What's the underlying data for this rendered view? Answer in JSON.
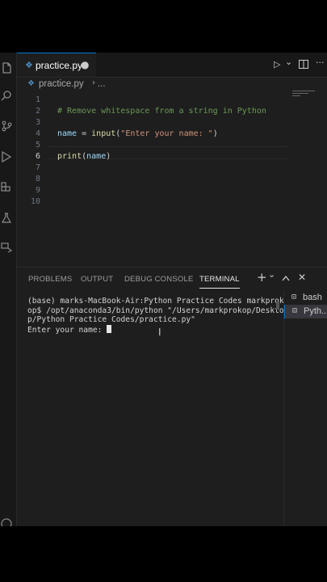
{
  "tab": {
    "filename": "practice.py",
    "close": "●"
  },
  "toolbar": {
    "run": "▷",
    "dropdown": "⌄",
    "split": "▯▯",
    "more": "···"
  },
  "breadcrumb": {
    "file": "practice.py",
    "separator": "›",
    "more": "..."
  },
  "editor": {
    "line_numbers": [
      "1",
      "2",
      "3",
      "4",
      "5",
      "6",
      "7",
      "8",
      "9",
      "10"
    ],
    "active_line": 6,
    "lines": [
      {
        "n": "1",
        "parts": []
      },
      {
        "n": "2",
        "parts": [
          {
            "c": "comment",
            "t": "# Remove whitespace from a string in Python"
          }
        ]
      },
      {
        "n": "3",
        "parts": []
      },
      {
        "n": "4",
        "parts": [
          {
            "c": "var",
            "t": "name"
          },
          {
            "c": "",
            "t": " = "
          },
          {
            "c": "fn",
            "t": "input"
          },
          {
            "c": "",
            "t": "("
          },
          {
            "c": "str",
            "t": "\"Enter your name: \""
          },
          {
            "c": "",
            "t": ")"
          }
        ]
      },
      {
        "n": "5",
        "parts": []
      },
      {
        "n": "6",
        "parts": [
          {
            "c": "fn",
            "t": "print"
          },
          {
            "c": "",
            "t": "("
          },
          {
            "c": "var",
            "t": "name"
          },
          {
            "c": "",
            "t": ")"
          }
        ]
      },
      {
        "n": "7",
        "parts": []
      },
      {
        "n": "8",
        "parts": []
      },
      {
        "n": "9",
        "parts": []
      },
      {
        "n": "10",
        "parts": []
      }
    ]
  },
  "panel": {
    "tabs": [
      "PROBLEMS",
      "OUTPUT",
      "DEBUG CONSOLE",
      "TERMINAL"
    ],
    "active_tab": "TERMINAL",
    "add": "+",
    "chevron": "⌄",
    "maximize": "^",
    "close": "✕"
  },
  "terminal": {
    "lines": [
      "(base) marks-MacBook-Air:Python Practice Codes markprok",
      "op$ /opt/anaconda3/bin/python \"/Users/markprokop/Deskto",
      "p/Python Practice Codes/practice.py\"",
      "Enter your name: "
    ]
  },
  "terminal_list": [
    {
      "icon": "⚲",
      "label": "bash",
      "selected": false
    },
    {
      "icon": "▷",
      "label": "Pyth...",
      "selected": true
    }
  ]
}
